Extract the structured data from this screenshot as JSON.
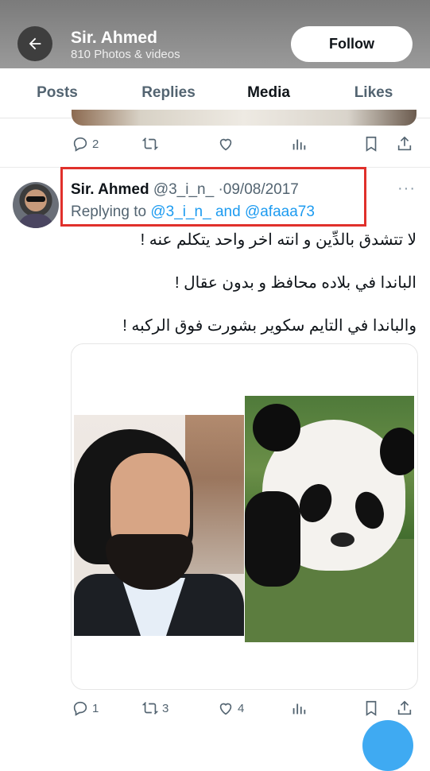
{
  "header": {
    "name": "Sir. Ahmed",
    "subtitle": "810 Photos & videos",
    "follow_label": "Follow"
  },
  "tabs": [
    {
      "label": "Posts",
      "active": false
    },
    {
      "label": "Replies",
      "active": false
    },
    {
      "label": "Media",
      "active": true
    },
    {
      "label": "Likes",
      "active": false
    }
  ],
  "prev_tweet": {
    "replies": "2",
    "retweets": "",
    "likes": ""
  },
  "tweet": {
    "author": "Sir. Ahmed",
    "handle": "@3_i_n_",
    "separator": "·",
    "date": "09/08/2017",
    "replying_prefix": "Replying to",
    "replying_to_1": "@3_i_n_",
    "replying_and": "and",
    "replying_to_2": "@afaaa73",
    "more": "···",
    "lines": [
      "لا تتشدق بالدِّين و انته اخر واحد يتكلم عنه !",
      "الباندا في بلاده محافظ و بدون عقال !",
      "والباندا في التايم سكوير بشورت فوق الركبه !"
    ],
    "replies": "1",
    "retweets": "3",
    "likes": "4"
  },
  "colors": {
    "accent": "#1d9bf0",
    "highlight_border": "#e0302b",
    "muted_text": "#536471"
  },
  "icons": [
    "back-arrow-icon",
    "reply-icon",
    "retweet-icon",
    "like-icon",
    "views-icon",
    "bookmark-icon",
    "share-icon"
  ]
}
